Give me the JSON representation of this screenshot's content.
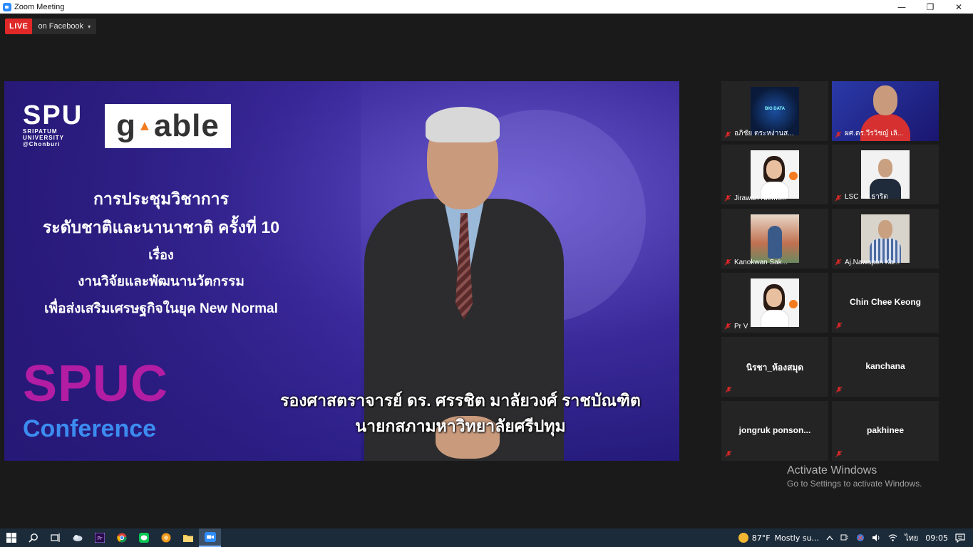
{
  "window": {
    "title": "Zoom Meeting",
    "minimize_glyph": "—",
    "restore_glyph": "❐",
    "close_glyph": "✕"
  },
  "live": {
    "badge": "LIVE",
    "destination": "on Facebook",
    "caret": "▾"
  },
  "main_video": {
    "spu_logo_big": "SPU",
    "spu_logo_line1": "SRIPATUM",
    "spu_logo_line2": "UNIVERSITY",
    "spu_logo_line3": "@Chonburi",
    "gable_left": "g",
    "gable_right": "able",
    "conference_lines": [
      "การประชุมวิชาการ",
      "ระดับชาติและนานาชาติ ครั้งที่ 10",
      "เรื่อง",
      "งานวิจัยและพัฒนานวัตกรรม",
      "เพื่อส่งเสริมเศรษฐกิจในยุค New Normal"
    ],
    "spuc": "SPUC",
    "conference_word": "Conference",
    "caption_line1": "รองศาสตราจารย์ ดร. ศรรชิต  มาลัยวงศ์ ราชบัณฑิต",
    "caption_line2": "นายกสภามหาวิทยาลัยศรีปทุม"
  },
  "gallery": [
    {
      "name": "อภิชัย ตระหง่านส...",
      "type": "video",
      "thumb": "bigdata",
      "thumb_text": "BIG DATA"
    },
    {
      "name": "ผศ.ดร.วีรวิชญ์ เลิ...",
      "type": "video",
      "thumb": "host"
    },
    {
      "name": "Jirawan Niems...",
      "type": "video",
      "thumb": "girl"
    },
    {
      "name": "LSC - อ.ธาริต",
      "type": "video",
      "thumb": "man"
    },
    {
      "name": "Kanokwan Sak...",
      "type": "video",
      "thumb": "kan"
    },
    {
      "name": "Aj.Nawapon Ka...",
      "type": "video",
      "thumb": "nawa"
    },
    {
      "name": "Pr V",
      "type": "video",
      "thumb": "girl"
    },
    {
      "name": "Chin Chee Keong",
      "type": "name"
    },
    {
      "name": "นิรชา_ห้องสมุด",
      "type": "name"
    },
    {
      "name": "kanchana",
      "type": "name"
    },
    {
      "name": "jongruk  ponson...",
      "type": "name"
    },
    {
      "name": "pakhinee",
      "type": "name"
    }
  ],
  "watermark": {
    "line1": "Activate Windows",
    "line2": "Go to Settings to activate Windows."
  },
  "taskbar": {
    "weather_temp": "87°F",
    "weather_desc": "Mostly su...",
    "language": "ไทย",
    "clock": "09:05"
  },
  "colors": {
    "live_red": "#e02828",
    "muted_red": "#e02828",
    "taskbar_bg": "#1c2b3a"
  }
}
